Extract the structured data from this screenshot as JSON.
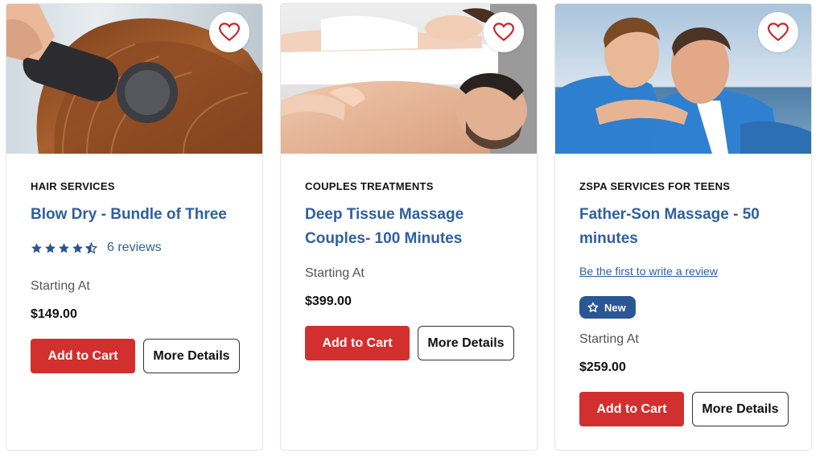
{
  "cards": [
    {
      "category": "HAIR SERVICES",
      "title": "Blow Dry - Bundle of Three",
      "rating": 4.5,
      "reviews": "6 reviews",
      "starting_label": "Starting At",
      "price": "$149.00",
      "add_to_cart": "Add to Cart",
      "more_details": "More Details",
      "favorite_icon": "heart-icon"
    },
    {
      "category": "COUPLES TREATMENTS",
      "title": "Deep Tissue Massage Couples- 100 Minutes",
      "starting_label": "Starting At",
      "price": "$399.00",
      "add_to_cart": "Add to Cart",
      "more_details": "More Details",
      "favorite_icon": "heart-icon"
    },
    {
      "category": "ZSPA SERVICES FOR TEENS",
      "title": "Father-Son Massage - 50 minutes",
      "write_review": "Be the first to write a review",
      "badge": "New",
      "badge_icon": "star-outline-icon",
      "starting_label": "Starting At",
      "price": "$259.00",
      "add_to_cart": "Add to Cart",
      "more_details": "More Details",
      "favorite_icon": "heart-icon"
    }
  ],
  "colors": {
    "title_blue": "#2f5f9f",
    "cart_red": "#d22f2f",
    "badge_blue": "#2a5694",
    "heart_red": "#c8232c"
  }
}
